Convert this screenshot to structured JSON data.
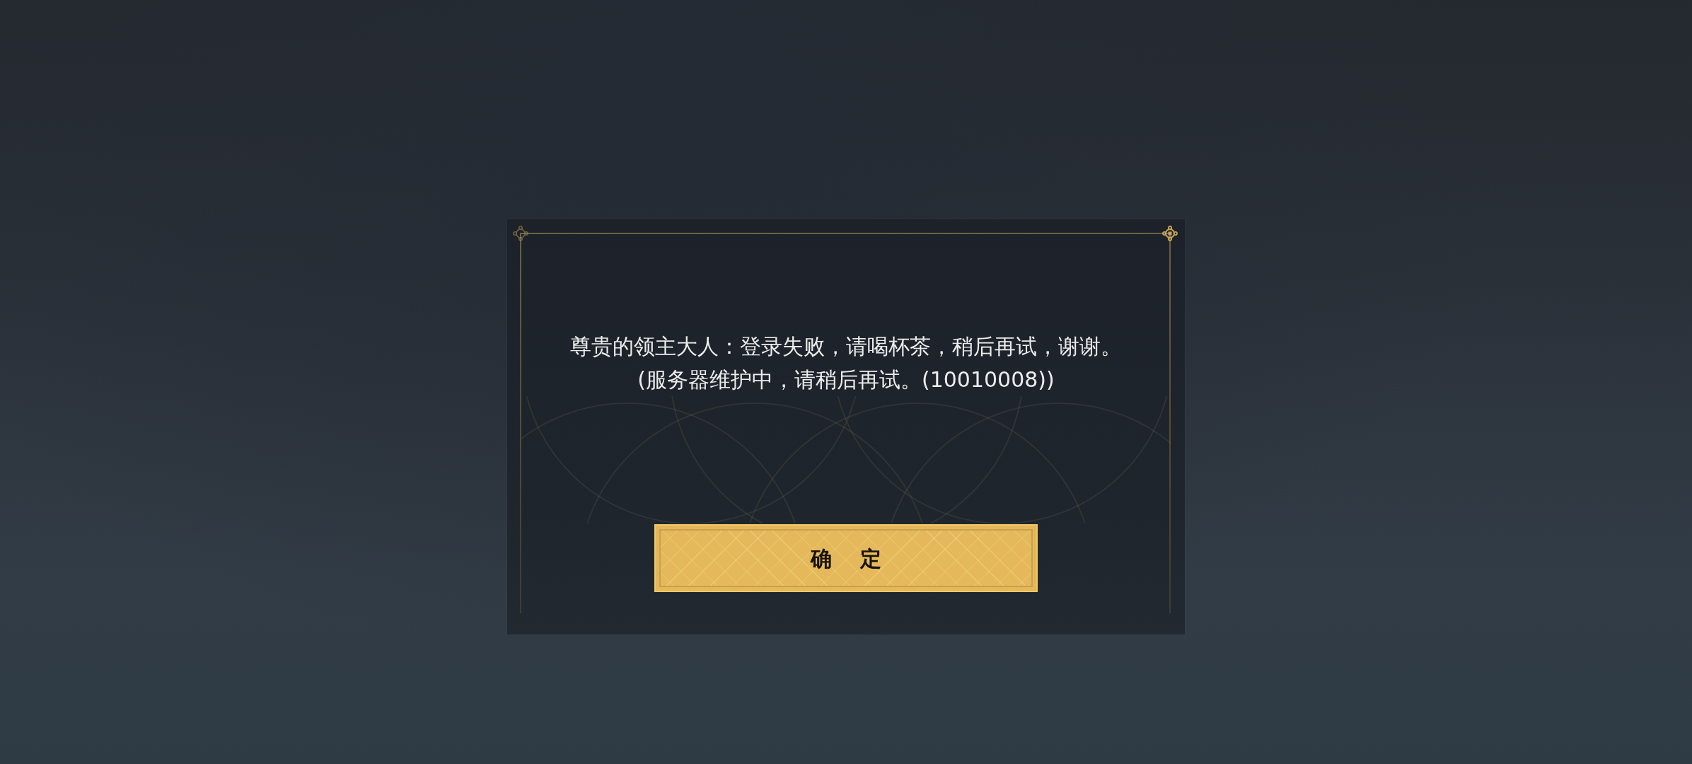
{
  "dialog": {
    "message_lines": [
      "尊贵的领主大人：登录失败，请喝杯茶，稍后再试，谢谢。",
      "(服务器维护中，请稍后再试。(10010008))"
    ],
    "button": {
      "label": "确 定"
    }
  }
}
